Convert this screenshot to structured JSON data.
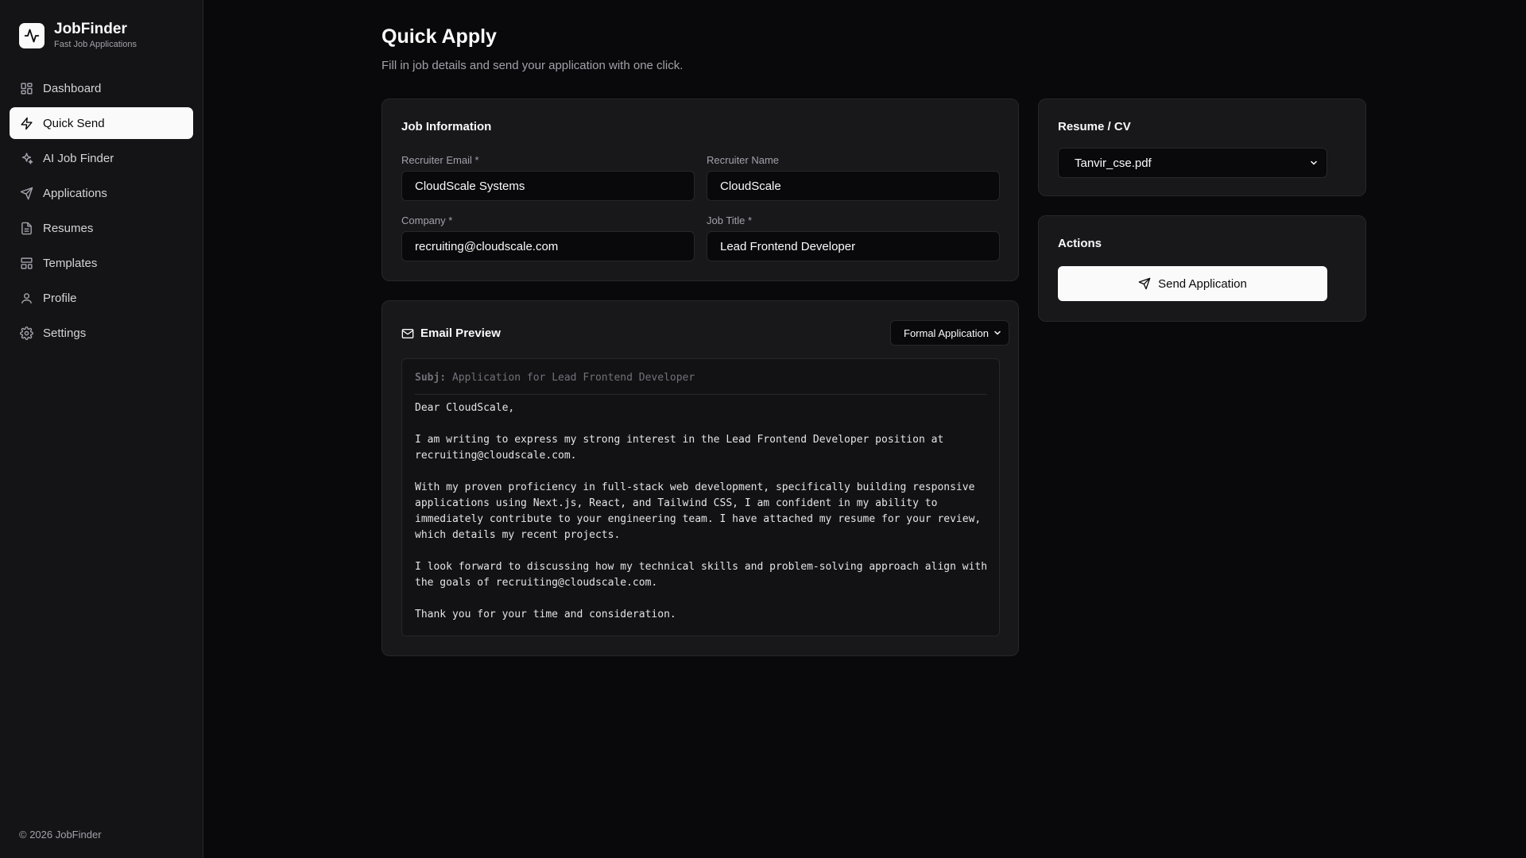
{
  "brand": {
    "name": "JobFinder",
    "subtitle": "Fast Job Applications"
  },
  "sidebar": {
    "items": [
      {
        "label": "Dashboard",
        "icon": "dashboard-icon"
      },
      {
        "label": "Quick Send",
        "icon": "lightning-icon",
        "active": true
      },
      {
        "label": "AI Job Finder",
        "icon": "sparkles-icon"
      },
      {
        "label": "Applications",
        "icon": "send-icon"
      },
      {
        "label": "Resumes",
        "icon": "document-icon"
      },
      {
        "label": "Templates",
        "icon": "template-icon"
      },
      {
        "label": "Profile",
        "icon": "user-icon"
      },
      {
        "label": "Settings",
        "icon": "gear-icon"
      }
    ],
    "footer": "© 2026 JobFinder"
  },
  "page": {
    "title": "Quick Apply",
    "subtitle": "Fill in job details and send your application with one click."
  },
  "job_info": {
    "title": "Job Information",
    "recruiter_email_label": "Recruiter Email *",
    "recruiter_email_value": "CloudScale Systems",
    "recruiter_name_label": "Recruiter Name",
    "recruiter_name_value": "CloudScale",
    "company_label": "Company *",
    "company_value": "recruiting@cloudscale.com",
    "job_title_label": "Job Title *",
    "job_title_value": "Lead Frontend Developer"
  },
  "email_preview": {
    "title": "Email Preview",
    "template_selected": "Formal Application",
    "subject_label": "Subj:",
    "subject": "Application for Lead Frontend Developer",
    "greeting": "Dear CloudScale,",
    "para1": "I am writing to express my strong interest in the Lead Frontend Developer position at recruiting@cloudscale.com.",
    "para2": "With my proven proficiency in full-stack web development, specifically building responsive applications using Next.js, React, and Tailwind CSS, I am confident in my ability to immediately contribute to your engineering team. I have attached my resume for your review, which details my recent projects.",
    "para3": "I look forward to discussing how my technical skills and problem-solving approach align with the goals of recruiting@cloudscale.com.",
    "closing": "Thank you for your time and consideration."
  },
  "resume": {
    "title": "Resume / CV",
    "selected": "Tanvir_cse.pdf"
  },
  "actions": {
    "title": "Actions",
    "send_label": "Send Application"
  },
  "colors": {
    "background": "#09090b",
    "card": "#18181b",
    "border": "#27272a",
    "accent": "#fafafa",
    "muted": "#a1a1aa"
  }
}
